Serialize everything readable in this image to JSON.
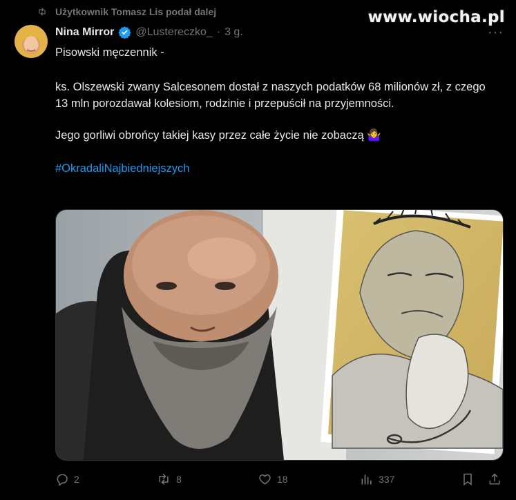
{
  "repost": {
    "text": "Użytkownik Tomasz Lis podał dalej",
    "icon": "repost-icon"
  },
  "watermark": "www.wiocha.pl",
  "author": {
    "name": "Nina Mirror",
    "handle": "@Lustereczko_",
    "separator": "·",
    "time": "3 g.",
    "verified": true
  },
  "tweet": {
    "line1": "Pisowski męczennik -",
    "para2": "ks. Olszewski zwany Salcesonem dostał z naszych podatków 68 milionów zł, z czego 13 mln porozdawał kolesiom, rodzinie i przepuścił na przyjemności.",
    "para3": "Jego gorliwi obrońcy takiej kasy przez całe życie nie zobaczą",
    "emoji": "🤷‍♀️",
    "hashtag": "#OkradaliNajbiedniejszych"
  },
  "metrics": {
    "replies": "2",
    "reposts": "8",
    "likes": "18",
    "views": "337"
  },
  "colors": {
    "background": "#000000",
    "text": "#e7e9ea",
    "muted": "#71767b",
    "link": "#1d9bf0",
    "verified": "#1d9bf0"
  }
}
